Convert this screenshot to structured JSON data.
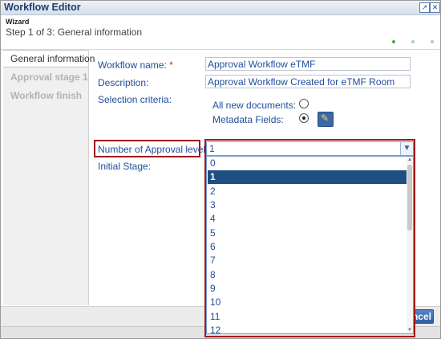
{
  "window": {
    "title": "Workflow Editor"
  },
  "header": {
    "wizard_label": "Wizard",
    "step_text": "Step 1 of 3: General information"
  },
  "nav": {
    "items": [
      {
        "label": "General information"
      },
      {
        "label": "Approval stage 1"
      },
      {
        "label": "Workflow finish"
      }
    ]
  },
  "form": {
    "workflow_name_label": "Workflow name:",
    "required_marker": "*",
    "workflow_name_value": "Approval Workflow eTMF",
    "description_label": "Description:",
    "description_value": "Approval Workflow Created for eTMF Room",
    "selection_criteria_label": "Selection criteria:",
    "all_new_documents_label": "All new documents:",
    "metadata_fields_label": "Metadata Fields:",
    "approval_levels_label": "Number of Approval levels:",
    "approval_levels_value": "1",
    "initial_stage_label": "Initial Stage:"
  },
  "dropdown": {
    "options": [
      "0",
      "1",
      "2",
      "3",
      "4",
      "5",
      "6",
      "7",
      "8",
      "9",
      "10",
      "11",
      "12"
    ],
    "selected": "1"
  },
  "footer": {
    "cancel_label": "Cancel"
  },
  "icons": {
    "maximize": "maximize-icon",
    "close": "close-icon",
    "pencil": "pencil-icon",
    "chevron": "chevron-down-icon"
  },
  "colors": {
    "accent": "#1f4e82",
    "highlight_border": "#9e1b1b",
    "label_text": "#1f4e9c"
  }
}
